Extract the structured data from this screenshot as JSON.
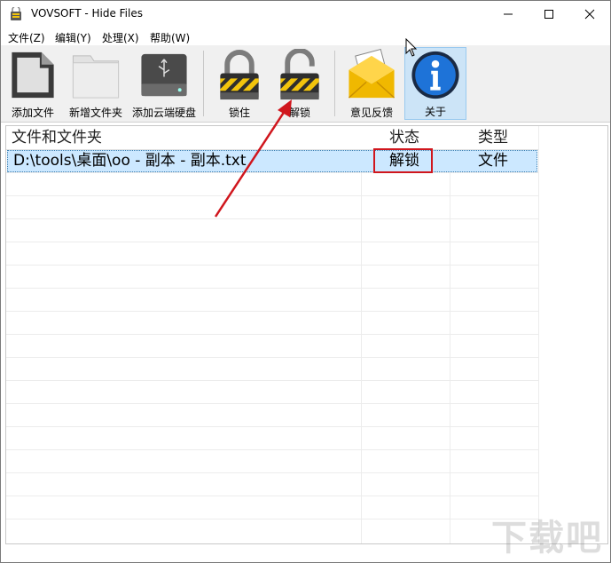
{
  "window": {
    "title": "VOVSOFT - Hide Files"
  },
  "menu": {
    "items": [
      "文件(Z)",
      "编辑(Y)",
      "处理(X)",
      "帮助(W)"
    ]
  },
  "toolbar": {
    "buttons": [
      {
        "label": "添加文件",
        "icon": "document-icon"
      },
      {
        "label": "新增文件夹",
        "icon": "folder-icon"
      },
      {
        "label": "添加云端硬盘",
        "icon": "usb-drive-icon"
      },
      {
        "label": "锁住",
        "icon": "lock-closed-icon"
      },
      {
        "label": "解锁",
        "icon": "lock-open-icon"
      },
      {
        "label": "意见反馈",
        "icon": "mail-icon"
      },
      {
        "label": "关于",
        "icon": "info-icon"
      }
    ]
  },
  "list": {
    "columns": [
      "文件和文件夹",
      "状态",
      "类型"
    ],
    "rows": [
      {
        "path": "D:\\tools\\桌面\\oo - 副本 - 副本.txt",
        "status": "解锁",
        "type": "文件"
      }
    ]
  },
  "watermark": "下载吧",
  "colors": {
    "selection": "#cce8ff",
    "annotation_red": "#d0161d",
    "active_button": "#cce4f7"
  }
}
